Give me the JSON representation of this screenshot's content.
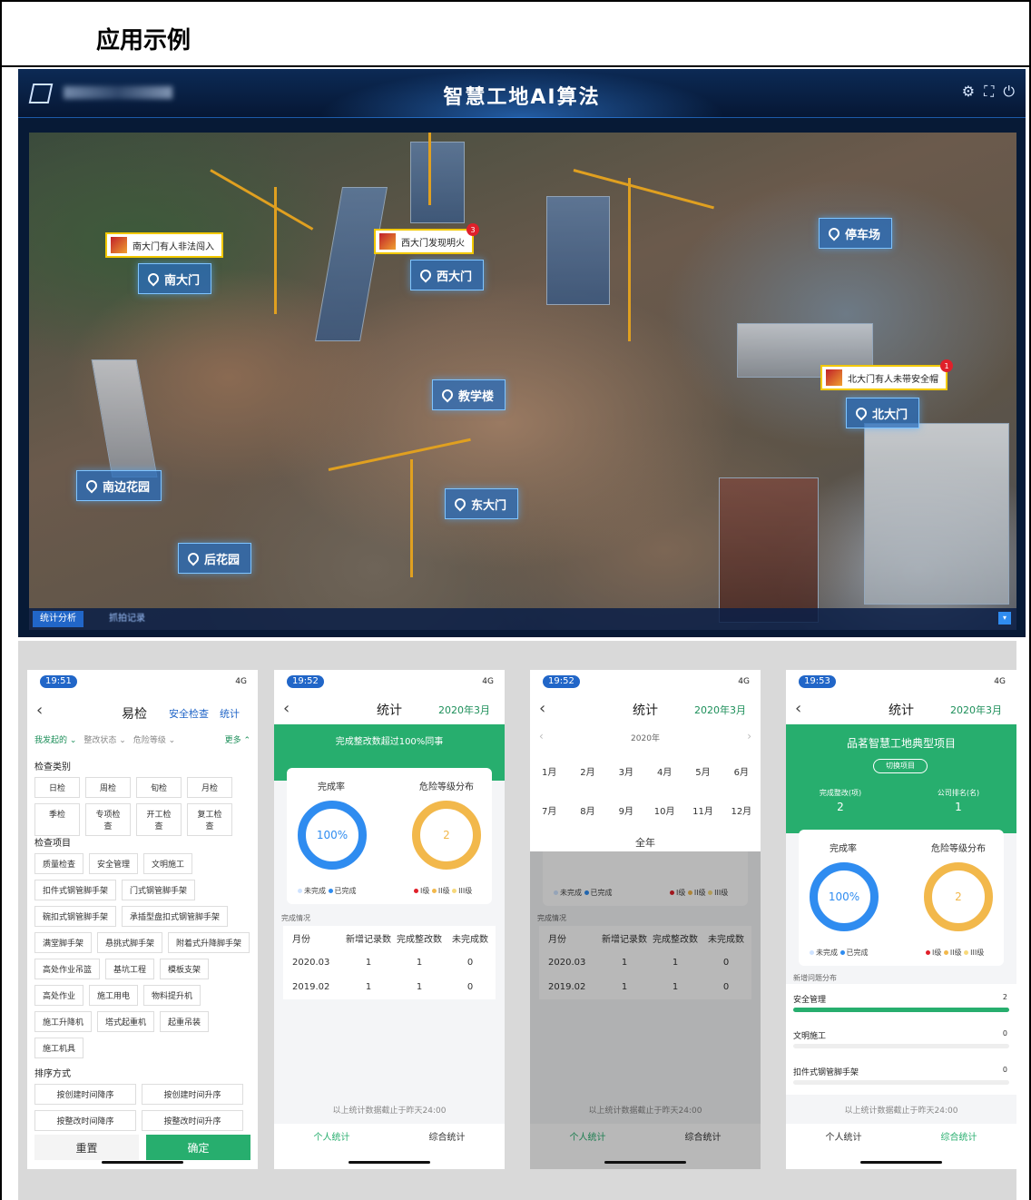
{
  "heading": "应用示例",
  "dashboard": {
    "title": "智慧工地AI算法",
    "pins": [
      "南大门",
      "西大门",
      "停车场",
      "教学楼",
      "北大门",
      "南边花园",
      "东大门",
      "后花园"
    ],
    "alerts": [
      {
        "text": "南大门有人非法闯入"
      },
      {
        "text": "西大门发现明火",
        "badge": "3"
      },
      {
        "text": "北大门有人未带安全帽",
        "badge": "1"
      }
    ],
    "bottom_tabs": [
      "统计分析",
      "抓拍记录"
    ]
  },
  "phone1": {
    "time": "19:51",
    "signal": "4G",
    "nav": {
      "title": "易检",
      "right": [
        "安全检查",
        "统计"
      ]
    },
    "filters": [
      "我发起的 ⌄",
      "整改状态 ⌄",
      "危险等级 ⌄",
      "更多 ⌃"
    ],
    "sections": {
      "type": "检查类别",
      "items": "检查项目",
      "sort": "排序方式"
    },
    "types": [
      "日检",
      "周检",
      "旬检",
      "月检",
      "季检",
      "专项检查",
      "开工检查",
      "复工检查"
    ],
    "items": [
      "质量检查",
      "安全管理",
      "文明施工",
      "扣件式钢管脚手架",
      "门式钢管脚手架",
      "碗扣式钢管脚手架",
      "承插型盘扣式钢管脚手架",
      "满堂脚手架",
      "悬挑式脚手架",
      "附着式升降脚手架",
      "高处作业吊篮",
      "基坑工程",
      "模板支架",
      "高处作业",
      "施工用电",
      "物料提升机",
      "施工升降机",
      "塔式起重机",
      "起重吊装",
      "施工机具"
    ],
    "sort": [
      "按创建时间降序",
      "按创建时间升序",
      "按整改时间降序",
      "按整改时间升序"
    ],
    "buttons": {
      "reset": "重置",
      "ok": "确定"
    }
  },
  "phone2": {
    "time": "19:52",
    "signal": "4G",
    "nav": {
      "title": "统计",
      "right": "2020年3月"
    },
    "banner": "完成整改数超过100%同事",
    "rate_label": "完成率",
    "rate_value": "100%",
    "dist_label": "危险等级分布",
    "dist_value": "2",
    "legend1": [
      "未完成",
      "已完成"
    ],
    "legend2": [
      "I级",
      "II级",
      "III级"
    ],
    "section": "完成情况",
    "table": {
      "headers": [
        "月份",
        "新增记录数",
        "完成整改数",
        "未完成数"
      ],
      "rows": [
        [
          "2020.03",
          "1",
          "1",
          "0"
        ],
        [
          "2019.02",
          "1",
          "1",
          "0"
        ]
      ]
    },
    "footnote": "以上统计数据截止于昨天24:00",
    "tabs": [
      "个人统计",
      "综合统计"
    ]
  },
  "phone3": {
    "time": "19:52",
    "signal": "4G",
    "nav": {
      "title": "统计",
      "right": "2020年3月"
    },
    "year": "2020年",
    "months": [
      "1月",
      "2月",
      "3月",
      "4月",
      "5月",
      "6月",
      "7月",
      "8月",
      "9月",
      "10月",
      "11月",
      "12月"
    ],
    "all_year": "全年",
    "legend1": [
      "未完成",
      "已完成"
    ],
    "legend2": [
      "I级",
      "II级",
      "III级"
    ],
    "section": "完成情况",
    "table": {
      "headers": [
        "月份",
        "新增记录数",
        "完成整改数",
        "未完成数"
      ],
      "rows": [
        [
          "2020.03",
          "1",
          "1",
          "0"
        ],
        [
          "2019.02",
          "1",
          "1",
          "0"
        ]
      ]
    },
    "footnote": "以上统计数据截止于昨天24:00",
    "tabs": [
      "个人统计",
      "综合统计"
    ]
  },
  "phone4": {
    "time": "19:53",
    "signal": "4G",
    "nav": {
      "title": "统计",
      "right": "2020年3月"
    },
    "project": "品茗智慧工地典型项目",
    "switch": "切换项目",
    "stat1_label": "完成整改(项)",
    "stat1_value": "2",
    "stat2_label": "公司排名(名)",
    "stat2_value": "1",
    "rate_label": "完成率",
    "rate_value": "100%",
    "dist_label": "危险等级分布",
    "dist_value": "2",
    "legend1": [
      "未完成",
      "已完成"
    ],
    "legend2": [
      "I级",
      "II级",
      "III级"
    ],
    "section": "新增问题分布",
    "bars": [
      {
        "label": "安全管理",
        "value": "2",
        "fill": 1
      },
      {
        "label": "文明施工",
        "value": "0",
        "fill": 0
      },
      {
        "label": "扣件式钢管脚手架",
        "value": "0",
        "fill": 0
      }
    ],
    "footnote": "以上统计数据截止于昨天24:00",
    "tabs": [
      "个人统计",
      "综合统计"
    ]
  },
  "colors": {
    "green": "#27ae6e",
    "blue": "#2f8cf0",
    "orange": "#f2b84b"
  }
}
